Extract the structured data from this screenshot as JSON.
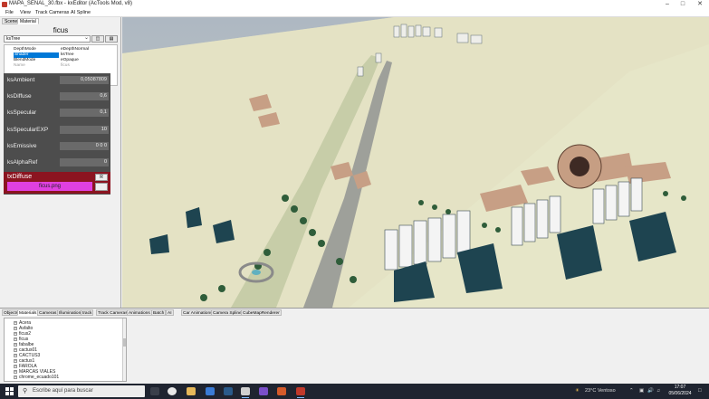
{
  "window": {
    "title": "MAPA_SENAL_30.fbx - kxEditor (AcTools Mod, v8)"
  },
  "menu": [
    "File",
    "View",
    "Track Cameras",
    "AI Spline"
  ],
  "left_tabs": [
    "Scene",
    "Material"
  ],
  "material": {
    "name": "ficus",
    "shader": "ksTree",
    "prop_rows": [
      {
        "key": "DepthMode",
        "value": "eDepthNormal"
      },
      {
        "key": "Shader",
        "value": "ksTree"
      },
      {
        "key": "BlendMode",
        "value": "eOpaque"
      },
      {
        "key": "Name",
        "value": "ficus"
      }
    ],
    "params": [
      {
        "label": "ksAmbient",
        "value": "0,05087809"
      },
      {
        "label": "ksDiffuse",
        "value": "0,6"
      },
      {
        "label": "ksSpecular",
        "value": "0,1"
      },
      {
        "label": "ksSpecularEXP",
        "value": "10"
      },
      {
        "label": "ksEmissive",
        "value": "0 0 0"
      },
      {
        "label": "ksAlphaRef",
        "value": "0"
      }
    ],
    "texture": {
      "label": "txDiffuse",
      "file": "ficus.png",
      "button": "R"
    }
  },
  "bottom_tabs": [
    "Objects",
    "Materials",
    "Cameras",
    "Illumination",
    "track",
    "Track Cameras",
    "Animations",
    "Batch",
    "AI",
    "Car Animations",
    "Camera Spline",
    "CubeMapRenderer"
  ],
  "material_list": [
    "Acera",
    "Asfalto",
    "ficus2",
    "ficus",
    "fabalbe",
    "cactus01",
    "CACTUS3",
    "cactus1",
    "FAROLA",
    "MARCAS VIALES",
    "chrome_ecuado101"
  ],
  "taskbar": {
    "search_placeholder": "Escribe aquí para buscar",
    "weather": "23°C  Ventoso",
    "time": "17:07",
    "date": "05/06/2024"
  },
  "colors": {
    "texture_panel": "#8b1420",
    "texture_field": "#e040e0",
    "ground": "#e6e6c8",
    "selection": "#0078d7"
  }
}
